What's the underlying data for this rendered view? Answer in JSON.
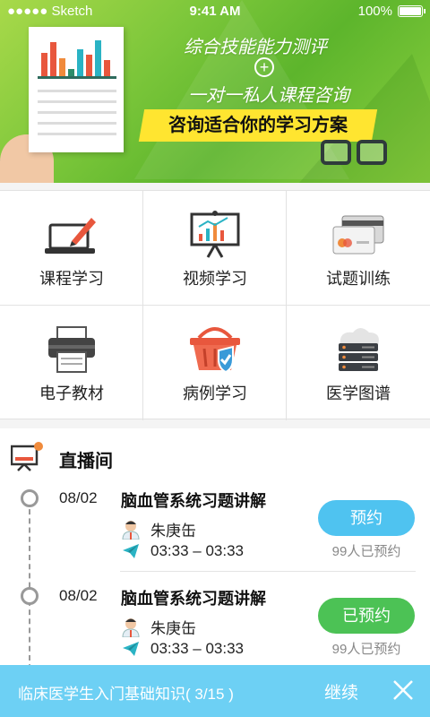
{
  "status_bar": {
    "carrier": "●●●●● Sketch",
    "time": "9:41 AM",
    "battery": "100%"
  },
  "banner": {
    "line1": "综合技能能力测评",
    "plus": "+",
    "line2": "一对一私人课程咨询",
    "highlight": "咨询适合你的学习方案"
  },
  "menu": {
    "items": [
      {
        "label": "课程学习",
        "icon": "laptop-pen-icon"
      },
      {
        "label": "视频学习",
        "icon": "presentation-board-icon"
      },
      {
        "label": "试题训练",
        "icon": "cards-icon"
      },
      {
        "label": "电子教材",
        "icon": "printer-icon"
      },
      {
        "label": "病例学习",
        "icon": "basket-shield-icon"
      },
      {
        "label": "医学图谱",
        "icon": "cloud-server-icon"
      }
    ]
  },
  "live": {
    "title": "直播间",
    "items": [
      {
        "date": "08/02",
        "title": "脑血管系统习题讲解",
        "teacher": "朱庚缶",
        "time": "03:33 – 03:33",
        "button": "预约",
        "count": "99人已预约",
        "button_color": "#4fc3f0"
      },
      {
        "date": "08/02",
        "title": "脑血管系统习题讲解",
        "teacher": "朱庚缶",
        "time": "03:33 – 03:33",
        "button": "已预约",
        "count": "99人已预约",
        "button_color": "#4cc255"
      }
    ]
  },
  "bottom_bar": {
    "text": "临床医学生入门基础知识( 3/15 )",
    "continue": "继续"
  },
  "colors": {
    "bottom_bar": "#6dd0f4",
    "highlight": "#ffe530"
  }
}
